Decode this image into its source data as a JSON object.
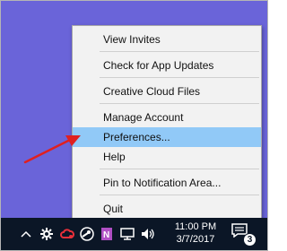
{
  "context_menu": {
    "items": [
      {
        "label": "View Invites",
        "highlighted": false
      },
      {
        "label": "Check for App Updates",
        "highlighted": false
      },
      {
        "label": "Creative Cloud Files",
        "highlighted": false
      },
      {
        "label": "Manage Account",
        "highlighted": false
      },
      {
        "label": "Preferences...",
        "highlighted": true
      },
      {
        "label": "Help",
        "highlighted": false
      },
      {
        "label": "Pin to Notification Area...",
        "highlighted": false
      },
      {
        "label": "Quit",
        "highlighted": false
      }
    ]
  },
  "taskbar": {
    "clock": {
      "time": "11:00 PM",
      "date": "3/7/2017"
    },
    "notification_count": "3",
    "tray_icons": [
      "chevron-up-icon",
      "settings-icon",
      "creative-cloud-icon",
      "steam-icon",
      "onenote-icon",
      "network-icon",
      "volume-icon",
      "notifications-icon"
    ]
  },
  "colors": {
    "desktop": "#6a64d9",
    "menu_background": "#f2f2f2",
    "highlight": "#91c9f7",
    "taskbar": "#0b1626",
    "arrow": "#e02020"
  }
}
